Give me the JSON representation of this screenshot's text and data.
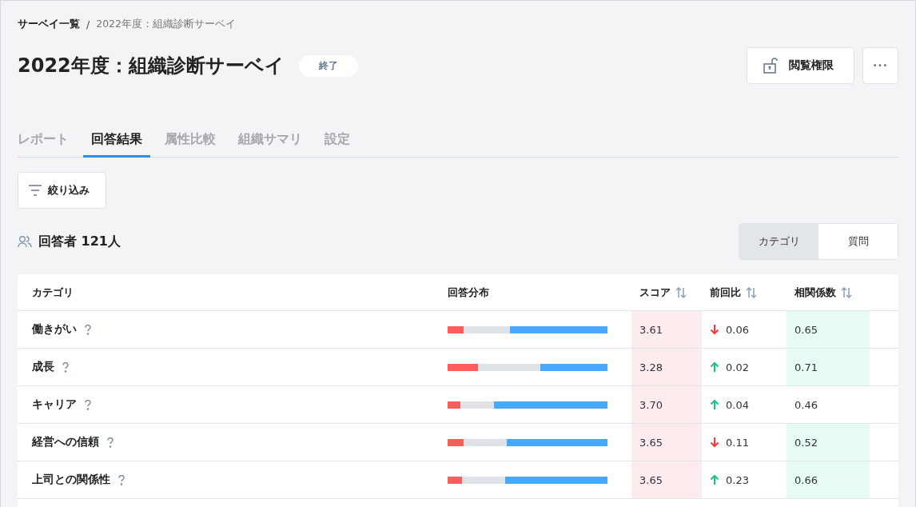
{
  "breadcrumb": [
    {
      "label": "サーベイ一覧",
      "kind": "link"
    },
    {
      "label": "/",
      "kind": "separator"
    },
    {
      "label": "2022年度：組織診断サーベイ",
      "kind": "current"
    }
  ],
  "title": "2022年度：組織診断サーベイ",
  "status_badge": "終了",
  "actions": {
    "permission_button": "閲覧権限",
    "more_button": "···"
  },
  "tabs": [
    {
      "label": "レポート",
      "selected": false
    },
    {
      "label": "回答結果",
      "selected": true
    },
    {
      "label": "属性比較",
      "selected": false
    },
    {
      "label": "組織サマリ",
      "selected": false
    },
    {
      "label": "設定",
      "selected": false
    }
  ],
  "filter_button": "絞り込み",
  "respondents": "回答者 121人",
  "view_toggle": [
    {
      "label": "カテゴリ",
      "selected": true
    },
    {
      "label": "質問",
      "selected": false
    }
  ],
  "table": {
    "columns": [
      {
        "label": "カテゴリ",
        "sortable": false
      },
      {
        "label": "回答分布",
        "sortable": false
      },
      {
        "label": "スコア",
        "sortable": true
      },
      {
        "label": "前回比",
        "sortable": true
      },
      {
        "label": "相関係数",
        "sortable": true
      }
    ],
    "rows": [
      {
        "category": "働きがい",
        "distribution": [
          {
            "kind": "negative",
            "level": 0.1
          },
          {
            "kind": "neutral",
            "level": 0.29
          },
          {
            "kind": "positive",
            "level": 0.61
          }
        ],
        "score": "3.61",
        "score_highlighted": true,
        "change": {
          "kind": "down",
          "value": "0.06"
        },
        "correlation": "0.65",
        "correlation_highlighted": true
      },
      {
        "category": "成長",
        "distribution": [
          {
            "kind": "negative",
            "level": 0.19
          },
          {
            "kind": "neutral",
            "level": 0.39
          },
          {
            "kind": "positive",
            "level": 0.42
          }
        ],
        "score": "3.28",
        "score_highlighted": true,
        "change": {
          "kind": "up",
          "value": "0.02"
        },
        "correlation": "0.71",
        "correlation_highlighted": true
      },
      {
        "category": "キャリア",
        "distribution": [
          {
            "kind": "negative",
            "level": 0.08
          },
          {
            "kind": "neutral",
            "level": 0.21
          },
          {
            "kind": "positive",
            "level": 0.71
          }
        ],
        "score": "3.70",
        "score_highlighted": true,
        "change": {
          "kind": "up",
          "value": "0.04"
        },
        "correlation": "0.46",
        "correlation_highlighted": false
      },
      {
        "category": "経営への信頼",
        "distribution": [
          {
            "kind": "negative",
            "level": 0.1
          },
          {
            "kind": "neutral",
            "level": 0.27
          },
          {
            "kind": "positive",
            "level": 0.63
          }
        ],
        "score": "3.65",
        "score_highlighted": true,
        "change": {
          "kind": "down",
          "value": "0.11"
        },
        "correlation": "0.52",
        "correlation_highlighted": true
      },
      {
        "category": "上司との関係性",
        "distribution": [
          {
            "kind": "negative",
            "level": 0.09
          },
          {
            "kind": "neutral",
            "level": 0.27
          },
          {
            "kind": "positive",
            "level": 0.64
          }
        ],
        "score": "3.65",
        "score_highlighted": true,
        "change": {
          "kind": "up",
          "value": "0.23"
        },
        "correlation": "0.66",
        "correlation_highlighted": true
      }
    ]
  }
}
